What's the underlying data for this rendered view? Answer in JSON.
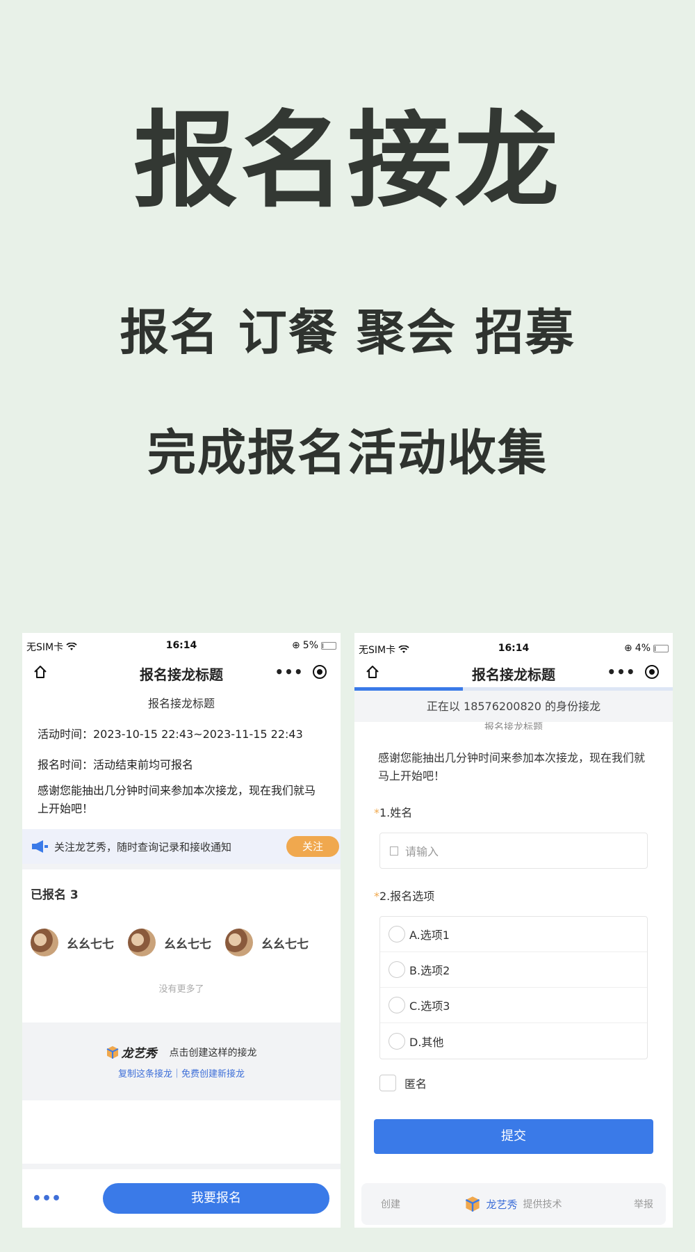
{
  "hero": {
    "title": "报名接龙",
    "subtitle": "报名 订餐 聚会 招募",
    "subtitle2": "完成报名活动收集"
  },
  "left_phone": {
    "status": {
      "carrier": "无SIM卡",
      "time": "16:14",
      "battery": "5%",
      "battery_level": 0.05
    },
    "nav_title": "报名接龙标题",
    "subtitle": "报名接龙标题",
    "activity_time": "活动时间：2023-10-15 22:43~2023-11-15 22:43",
    "signup_time": "报名时间：活动结束前均可报名",
    "description": "感谢您能抽出几分钟时间来参加本次接龙，现在我们就马上开始吧！",
    "follow_text": "关注龙艺秀，随时查询记录和接收通知",
    "follow_button": "关注",
    "signed_count": "已报名 3",
    "participants": [
      "幺幺七七",
      "幺幺七七",
      "幺幺七七"
    ],
    "no_more": "没有更多了",
    "promo_brand": "龙艺秀",
    "promo_text": "点击创建这样的接龙",
    "promo_links": "复制这条接龙｜免费创建新接龙",
    "more_dots": "•••",
    "signup_button": "我要报名"
  },
  "right_phone": {
    "status": {
      "carrier": "无SIM卡",
      "time": "16:14",
      "battery": "4%",
      "battery_level": 0.04
    },
    "nav_title": "报名接龙标题",
    "identity": "正在以 18576200820 的身份接龙",
    "subtitle": "报名接龙标题",
    "description": "感谢您能抽出几分钟时间来参加本次接龙，现在我们就马上开始吧！",
    "q1_label": "1.姓名",
    "q1_placeholder": "请输入",
    "q2_label": "2.报名选项",
    "options": [
      "A.选项1",
      "B.选项2",
      "C.选项3",
      "D.其他"
    ],
    "anonymous": "匿名",
    "submit": "提交",
    "footer_create": "创建",
    "footer_brand": "龙艺秀",
    "footer_tech": "提供技术",
    "footer_report": "举报"
  },
  "colors": {
    "background": "#e8f1e8",
    "accent": "#3a7ae8",
    "follow": "#f0a84e"
  }
}
